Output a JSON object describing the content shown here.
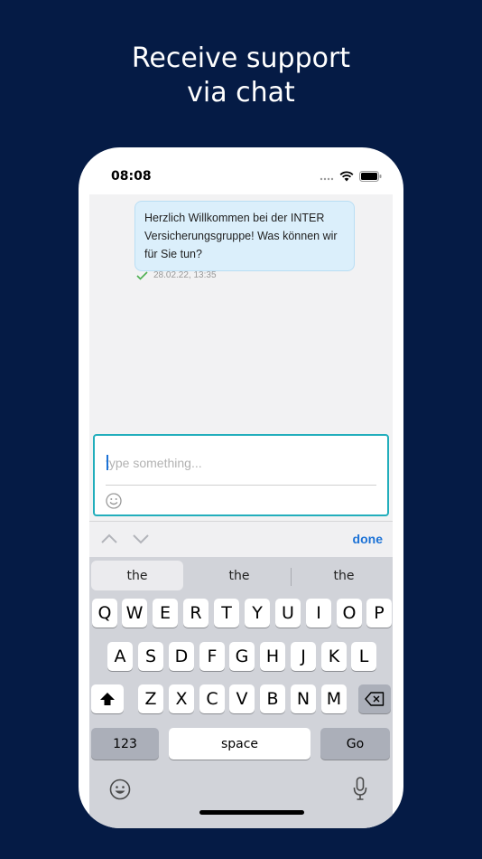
{
  "headline": {
    "line1": "Receive support",
    "line2": "via chat"
  },
  "status_bar": {
    "time": "08:08"
  },
  "chat": {
    "message": "Herzlich Willkommen bei der INTER Versicherungsgruppe! Was können wir für Sie tun?",
    "timestamp": "28.02.22, 13:35"
  },
  "input": {
    "placeholder": "type something...",
    "value": ""
  },
  "accessory_bar": {
    "done_label": "done"
  },
  "keyboard": {
    "suggestions": [
      "the",
      "the",
      "the"
    ],
    "row1": [
      "Q",
      "W",
      "E",
      "R",
      "T",
      "Y",
      "U",
      "I",
      "O",
      "P"
    ],
    "row2": [
      "A",
      "S",
      "D",
      "F",
      "G",
      "H",
      "J",
      "K",
      "L"
    ],
    "row3": [
      "Z",
      "X",
      "C",
      "V",
      "B",
      "N",
      "M"
    ],
    "numbers_label": "123",
    "space_label": "space",
    "go_label": "Go"
  },
  "colors": {
    "background": "#051b45",
    "accent": "#1c72d6",
    "input_border": "#22aebc",
    "bubble": "#dbeffb",
    "check": "#4caf50"
  }
}
